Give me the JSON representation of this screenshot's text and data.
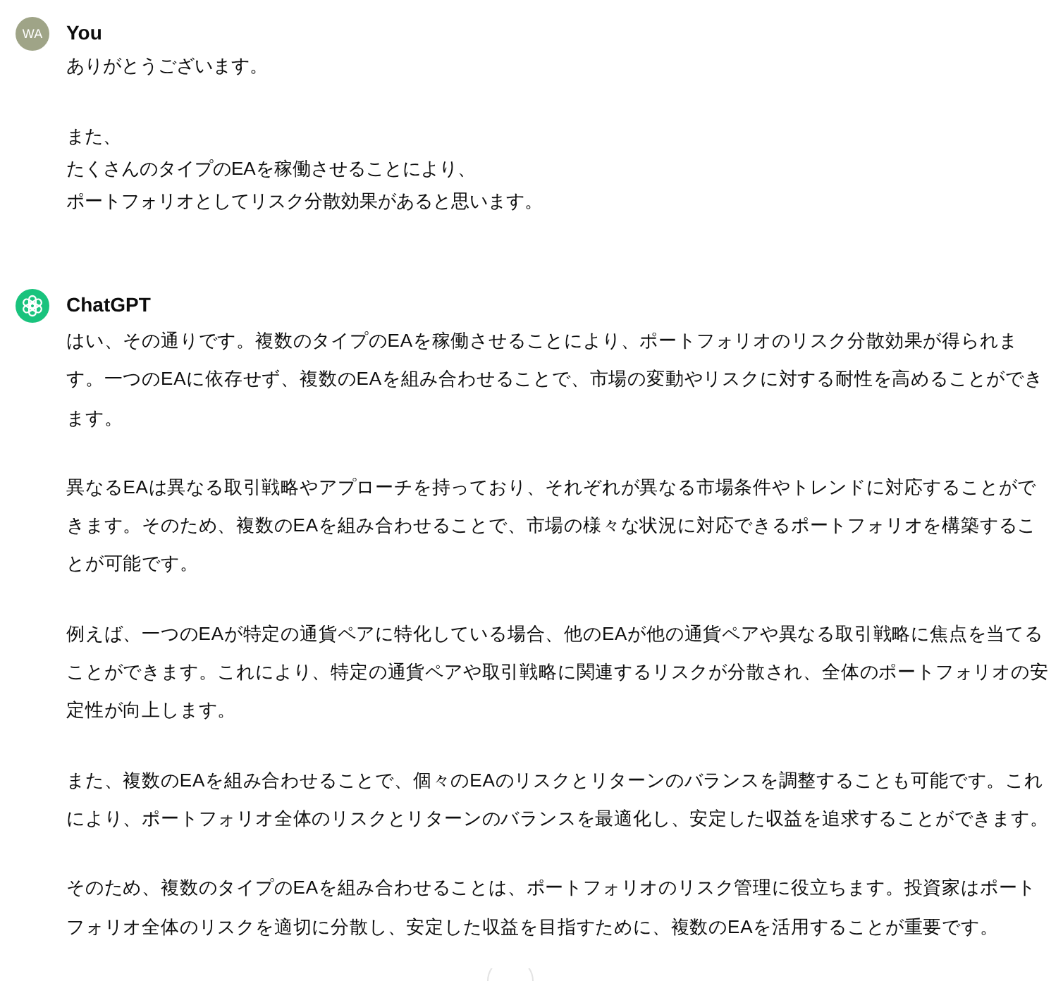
{
  "messages": [
    {
      "kind": "user",
      "author": "You",
      "initials": "WA",
      "paragraphs": [
        [
          "ありがとうございます。"
        ],
        [
          "また、",
          "たくさんのタイプのEAを稼働させることにより、",
          "ポートフォリオとしてリスク分散効果があると思います。"
        ]
      ]
    },
    {
      "kind": "assistant",
      "author": "ChatGPT",
      "paragraphs": [
        [
          "はい、その通りです。複数のタイプのEAを稼働させることにより、ポートフォリオのリスク分散効果が得られます。一つのEAに依存せず、複数のEAを組み合わせることで、市場の変動やリスクに対する耐性を高めることができます。"
        ],
        [
          "異なるEAは異なる取引戦略やアプローチを持っており、それぞれが異なる市場条件やトレンドに対応することができます。そのため、複数のEAを組み合わせることで、市場の様々な状況に対応できるポートフォリオを構築することが可能です。"
        ],
        [
          "例えば、一つのEAが特定の通貨ペアに特化している場合、他のEAが他の通貨ペアや異なる取引戦略に焦点を当てることができます。これにより、特定の通貨ペアや取引戦略に関連するリスクが分散され、全体のポートフォリオの安定性が向上します。"
        ],
        [
          "また、複数のEAを組み合わせることで、個々のEAのリスクとリターンのバランスを調整することも可能です。これにより、ポートフォリオ全体のリスクとリターンのバランスを最適化し、安定した収益を追求することができます。"
        ],
        [
          "そのため、複数のタイプのEAを組み合わせることは、ポートフォリオのリスク管理に役立ちます。投資家はポートフォリオ全体のリスクを適切に分散し、安定した収益を目指すために、複数のEAを活用することが重要です。"
        ]
      ]
    }
  ]
}
